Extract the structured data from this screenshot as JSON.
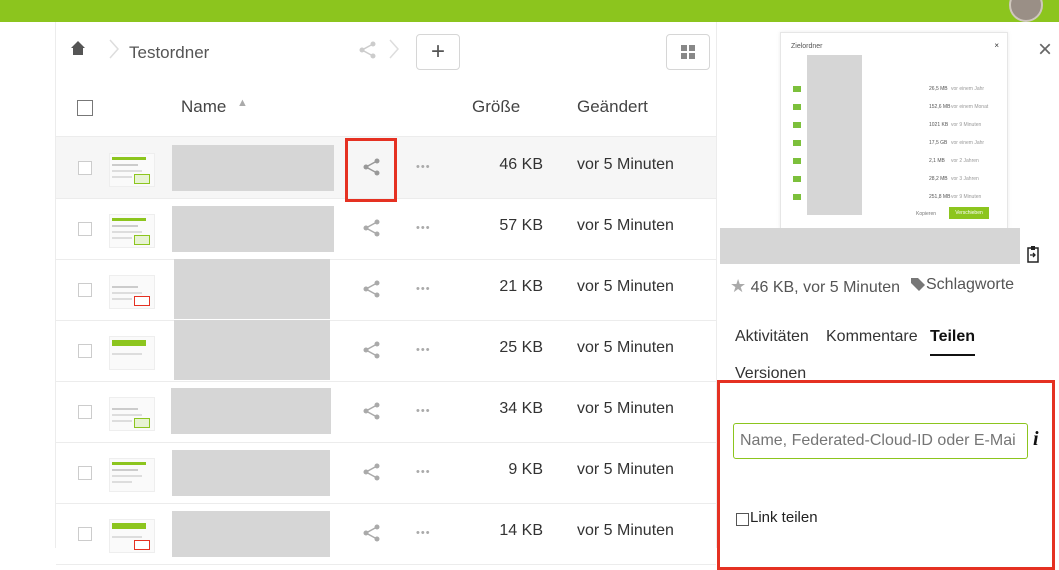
{
  "breadcrumb": {
    "folder": "Testordner"
  },
  "toolbar": {
    "new_label": "+"
  },
  "table": {
    "headers": {
      "name": "Name",
      "size": "Größe",
      "modified": "Geändert",
      "sort_indicator": "▲"
    },
    "rows": [
      {
        "size": "46 KB",
        "modified": "vor 5 Minuten"
      },
      {
        "size": "57 KB",
        "modified": "vor 5 Minuten"
      },
      {
        "size": "21 KB",
        "modified": "vor 5 Minuten"
      },
      {
        "size": "25 KB",
        "modified": "vor 5 Minuten"
      },
      {
        "size": "34 KB",
        "modified": "vor 5 Minuten"
      },
      {
        "size": "9 KB",
        "modified": "vor 5 Minuten"
      },
      {
        "size": "14 KB",
        "modified": "vor 5 Minuten"
      }
    ],
    "dots": "•••"
  },
  "sidebar": {
    "close": "×",
    "preview": {
      "title": "Zielordner",
      "close": "×",
      "rows": [
        {
          "size": "26,5 MB",
          "when": "vor einem Jahr"
        },
        {
          "size": "152,6 MB",
          "when": "vor einem Monat"
        },
        {
          "size": "1021 KB",
          "when": "vor 9 Minuten"
        },
        {
          "size": "17,5 GB",
          "when": "vor einem Jahr"
        },
        {
          "size": "2,1 MB",
          "when": "vor 2 Jahren"
        },
        {
          "size": "28,2 MB",
          "when": "vor 3 Jahren"
        },
        {
          "size": "251,8 MB",
          "when": "vor 9 Minuten"
        }
      ],
      "copy_label": "Kopieren",
      "move_label": "Verschieben"
    },
    "meta": {
      "star": "★",
      "text": "46 KB, vor 5 Minuten",
      "tags": "Schlagworte"
    },
    "tabs": [
      {
        "label": "Aktivitäten"
      },
      {
        "label": "Kommentare"
      },
      {
        "label": "Teilen"
      },
      {
        "label": "Versionen"
      }
    ],
    "share": {
      "input_placeholder": "Name, Federated-Cloud-ID oder E-Mai",
      "info": "i",
      "link_label": "Link teilen"
    }
  },
  "colors": {
    "brand": "#8cc51e",
    "highlight": "#e53122"
  }
}
